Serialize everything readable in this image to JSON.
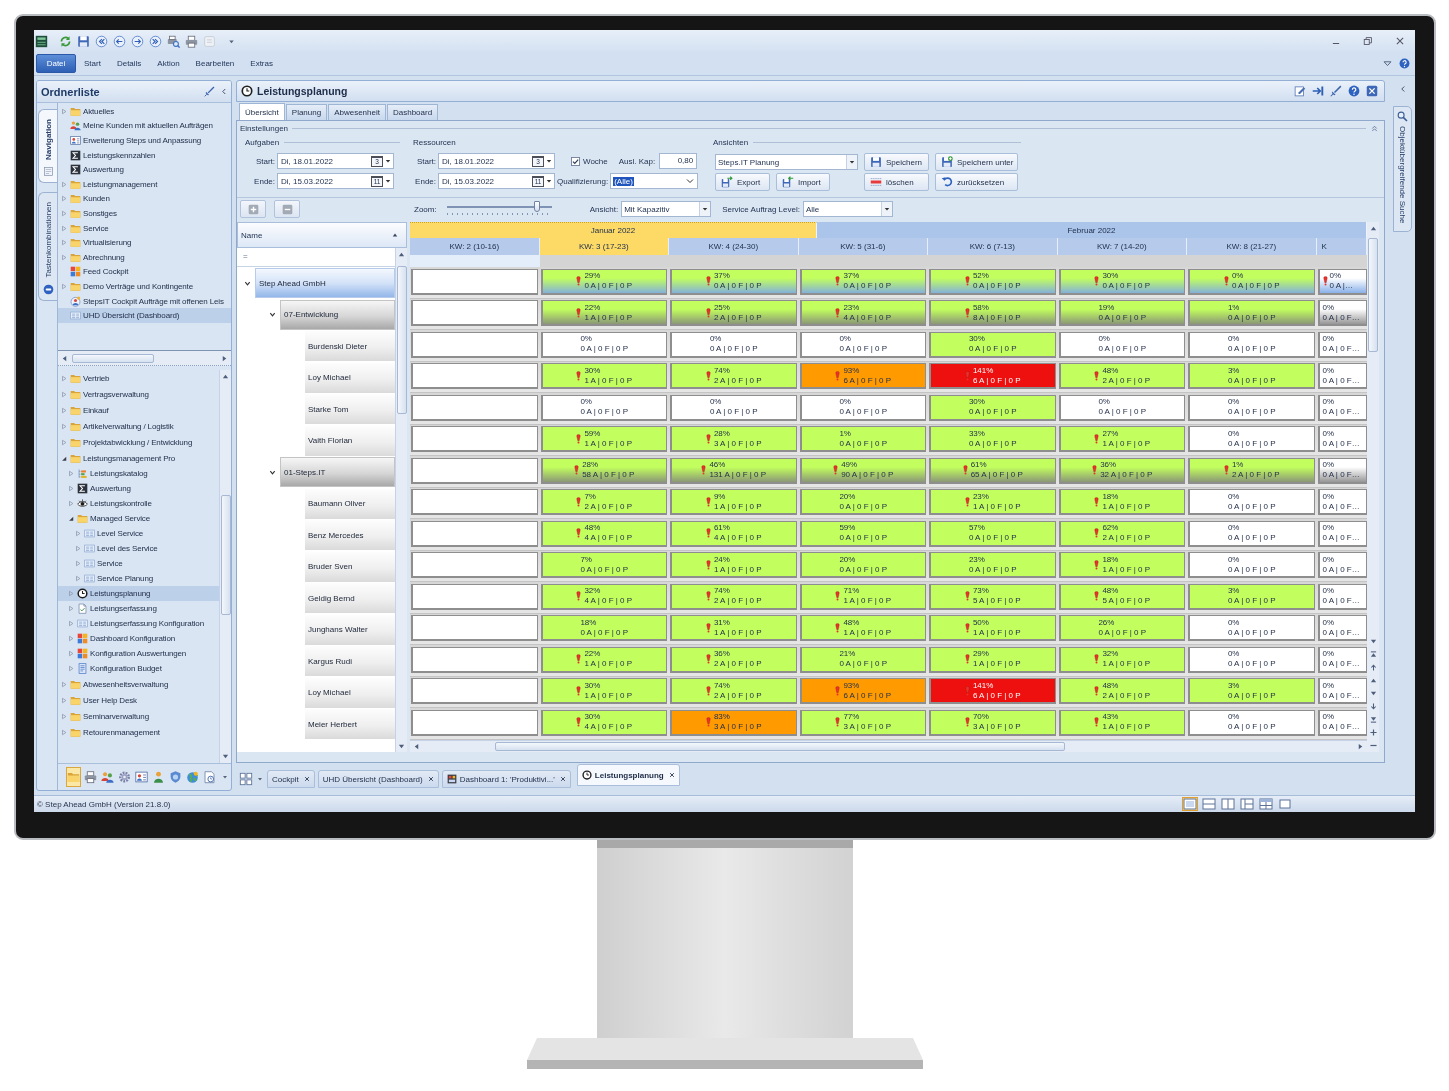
{
  "ribbon": {
    "file_button": "Datei",
    "tabs": [
      "Start",
      "Details",
      "Aktion",
      "Bearbeiten",
      "Extras"
    ]
  },
  "folder_panel": {
    "title": "Ordnerliste",
    "side_tabs": [
      {
        "label": "Navigation",
        "kind": "navigation",
        "selected": true
      },
      {
        "label": "Tastenkombinationen",
        "kind": "shortcuts",
        "selected": false
      }
    ],
    "tree_top": [
      {
        "label": "Aktuelles",
        "kind": "folder",
        "expanded": false,
        "selected": false
      },
      {
        "label": "Meine Kunden mit aktuellen Aufträgen",
        "kind": "people",
        "selected": false
      },
      {
        "label": "Erweiterung Steps und Anpassung",
        "kind": "card",
        "selected": false
      },
      {
        "label": "Leistungskennzahlen",
        "kind": "sigma",
        "selected": false
      },
      {
        "label": "Auswertung",
        "kind": "sigma",
        "selected": false
      },
      {
        "label": "Leistungmanagement",
        "kind": "folder",
        "expanded": false,
        "selected": false
      },
      {
        "label": "Kunden",
        "kind": "folder",
        "expanded": false,
        "selected": false
      },
      {
        "label": "Sonstiges",
        "kind": "folder",
        "expanded": false,
        "selected": false
      },
      {
        "label": "Service",
        "kind": "folder",
        "expanded": false,
        "selected": false
      },
      {
        "label": "Virtualisierung",
        "kind": "folder",
        "expanded": false,
        "selected": false
      },
      {
        "label": "Abrechnung",
        "kind": "folder",
        "expanded": false,
        "selected": false
      },
      {
        "label": "Feed Cockpit",
        "kind": "blocks",
        "selected": false
      },
      {
        "label": "Demo Verträge und Kontingente",
        "kind": "folder",
        "expanded": false,
        "selected": false
      },
      {
        "label": "StepsIT Cockpit Aufträge mit offenen Leis",
        "kind": "cockpit",
        "selected": false
      },
      {
        "label": "UHD Übersicht (Dashboard)",
        "kind": "table",
        "selected": true
      }
    ],
    "tree_bottom": [
      {
        "label": "Vertrieb",
        "kind": "folder",
        "expanded": false,
        "selected": false
      },
      {
        "label": "Vertragsverwaltung",
        "kind": "folder",
        "expanded": false,
        "selected": false
      },
      {
        "label": "Einkauf",
        "kind": "folder",
        "expanded": false,
        "selected": false
      },
      {
        "label": "Artikelverwaltung / Logistik",
        "kind": "folder",
        "expanded": false,
        "selected": false
      },
      {
        "label": "Projektabwicklung / Entwicklung",
        "kind": "folder",
        "expanded": false,
        "selected": false
      },
      {
        "label": "Leistungsmanagement Pro",
        "kind": "folder",
        "expanded": true,
        "selected": false,
        "children": [
          {
            "label": "Leistungskatalog",
            "kind": "list",
            "expanded": false,
            "selected": false
          },
          {
            "label": "Auswertung",
            "kind": "sigma",
            "expanded": false,
            "selected": false
          },
          {
            "label": "Leistungskontrolle",
            "kind": "eye",
            "expanded": false,
            "selected": false
          },
          {
            "label": "Managed Service",
            "kind": "folder",
            "expanded": true,
            "selected": false,
            "children": [
              {
                "label": "Level Service",
                "kind": "table",
                "expanded": false,
                "selected": false
              },
              {
                "label": "Level des Service",
                "kind": "table",
                "expanded": false,
                "selected": false
              },
              {
                "label": "Service",
                "kind": "table",
                "expanded": false,
                "selected": false
              },
              {
                "label": "Service Planung",
                "kind": "table",
                "expanded": false,
                "selected": false
              }
            ]
          },
          {
            "label": "Leistungsplanung",
            "kind": "clock",
            "expanded": false,
            "selected": true
          },
          {
            "label": "Leistungserfassung",
            "kind": "doc",
            "expanded": false,
            "selected": false
          },
          {
            "label": "Leistungserfassung Konfiguration",
            "kind": "table",
            "expanded": false,
            "selected": false
          },
          {
            "label": "Dashboard Konfiguration",
            "kind": "blocks",
            "expanded": false,
            "selected": false
          },
          {
            "label": "Konfiguration Auswertungen",
            "kind": "blocks",
            "expanded": false,
            "selected": false
          },
          {
            "label": "Konfiguration Budget",
            "kind": "budget",
            "expanded": false,
            "selected": false
          }
        ]
      },
      {
        "label": "Abwesenheitsverwaltung",
        "kind": "folder",
        "expanded": false,
        "selected": false
      },
      {
        "label": "User Help Desk",
        "kind": "folder",
        "expanded": false,
        "selected": false
      },
      {
        "label": "Seminarverwaltung",
        "kind": "folder",
        "expanded": false,
        "selected": false
      },
      {
        "label": "Retourenmanagement",
        "kind": "folder",
        "expanded": false,
        "selected": false
      }
    ],
    "shortcut_buttons": [
      {
        "kind": "folder",
        "selected": true
      },
      {
        "kind": "printer",
        "selected": false
      },
      {
        "kind": "people",
        "selected": false
      },
      {
        "kind": "gear",
        "selected": false
      },
      {
        "kind": "card",
        "selected": false
      },
      {
        "kind": "person",
        "selected": false
      },
      {
        "kind": "shield",
        "selected": false
      },
      {
        "kind": "globe",
        "selected": false
      },
      {
        "kind": "report",
        "selected": false
      }
    ]
  },
  "module": {
    "title": "Leistungsplanung",
    "tabs": [
      {
        "label": "Übersicht",
        "selected": true
      },
      {
        "label": "Planung",
        "selected": false
      },
      {
        "label": "Abwesenheit",
        "selected": false
      },
      {
        "label": "Dashboard",
        "selected": false
      }
    ],
    "settings": {
      "title": "Einstellungen",
      "tasks": {
        "title": "Aufgaben",
        "start": {
          "label": "Start:",
          "value": "Di, 18.01.2022",
          "day": "3"
        },
        "end": {
          "label": "Ende:",
          "value": "Di, 15.03.2022",
          "day": "11"
        }
      },
      "resources": {
        "title": "Ressourcen",
        "start": {
          "label": "Start:",
          "value": "Di, 18.01.2022",
          "day": "3"
        },
        "end": {
          "label": "Ende:",
          "value": "Di, 15.03.2022",
          "day": "11"
        },
        "week": {
          "label": "Woche",
          "checked": true
        },
        "capacity": {
          "label": "Ausl. Kap:",
          "value": "0,80"
        },
        "qualification": {
          "label": "Qualifizierung:",
          "value": "(Alle)",
          "highlighted": true
        }
      },
      "views": {
        "title": "Ansichten",
        "layout": "Steps.IT Planung",
        "buttons": [
          {
            "label": "Speichern",
            "kind": "save"
          },
          {
            "label": "Speichern unter",
            "kind": "save_as"
          },
          {
            "label": "Export",
            "kind": "export"
          },
          {
            "label": "Import",
            "kind": "import"
          },
          {
            "label": "löschen",
            "kind": "delete"
          },
          {
            "label": "zurücksetzen",
            "kind": "reset"
          }
        ]
      }
    },
    "toolbar": {
      "zoom": {
        "label": "Zoom:",
        "level": 0.86
      },
      "view": {
        "label": "Ansicht:",
        "value": "Mit Kapazitiv"
      },
      "service_level": {
        "label": "Service Auftrag Level:",
        "value": "Alle"
      }
    },
    "grid": {
      "name_header": "Name",
      "filter": "=",
      "months": [
        {
          "label": "Januar 2022",
          "current": true
        },
        {
          "label": "Februar 2022",
          "current": false
        }
      ],
      "weeks": [
        {
          "label": "KW: 2 (10-16)",
          "current": false
        },
        {
          "label": "KW: 3 (17-23)",
          "current": true
        },
        {
          "label": "KW: 4 (24-30)",
          "current": false
        },
        {
          "label": "KW: 5 (31-6)",
          "current": false
        },
        {
          "label": "KW: 6 (7-13)",
          "current": false
        },
        {
          "label": "KW: 7 (14-20)",
          "current": false
        },
        {
          "label": "KW: 8 (21-27)",
          "current": false
        },
        {
          "label": "K",
          "current": false
        }
      ],
      "rows": [
        {
          "name": "Step Ahead GmbH",
          "kind": "company",
          "expanded": true,
          "cells": [
            {
              "percent": "29%",
              "counts": "0 A | 0 F | 0 P",
              "color": "#c2ff5e",
              "warning": true
            },
            {
              "percent": "37%",
              "counts": "0 A | 0 F | 0 P",
              "color": "#c2ff5e",
              "warning": true
            },
            {
              "percent": "37%",
              "counts": "0 A | 0 F | 0 P",
              "color": "#c2ff5e",
              "warning": true
            },
            {
              "percent": "52%",
              "counts": "0 A | 0 F | 0 P",
              "color": "#c2ff5e",
              "warning": true
            },
            {
              "percent": "30%",
              "counts": "0 A | 0 F | 0 P",
              "color": "#c2ff5e",
              "warning": true
            },
            {
              "percent": "0%",
              "counts": "0 A | 0 F | 0 P",
              "color": "#c2ff5e",
              "warning": true
            },
            {
              "percent": "0%",
              "counts": "0 A |…",
              "color": "#ffffff",
              "warning": true
            }
          ],
          "children": [
            {
              "name": "07-Entwicklung",
              "kind": "team",
              "expanded": true,
              "cells": [
                {
                  "percent": "22%",
                  "counts": "1 A | 0 F | 0 P",
                  "color": "#c2ff5e",
                  "warning": true
                },
                {
                  "percent": "25%",
                  "counts": "2 A | 0 F | 0 P",
                  "color": "#c2ff5e",
                  "warning": true
                },
                {
                  "percent": "23%",
                  "counts": "4 A | 0 F | 0 P",
                  "color": "#c2ff5e",
                  "warning": true
                },
                {
                  "percent": "58%",
                  "counts": "8 A | 0 F | 0 P",
                  "color": "#c2ff5e",
                  "warning": true
                },
                {
                  "percent": "19%",
                  "counts": "0 A | 0 F | 0 P",
                  "color": "#c2ff5e",
                  "warning": false
                },
                {
                  "percent": "1%",
                  "counts": "0 A | 0 F | 0 P",
                  "color": "#c2ff5e",
                  "warning": false
                },
                {
                  "percent": "0%",
                  "counts": "0 A | 0 F…",
                  "color": "#ffffff",
                  "warning": false
                }
              ],
              "children": [
                {
                  "name": "Burdenski Dieter",
                  "kind": "person",
                  "cells": [
                    {
                      "percent": "0%",
                      "counts": "0 A | 0 F | 0 P",
                      "color": "#ffffff",
                      "warning": false
                    },
                    {
                      "percent": "0%",
                      "counts": "0 A | 0 F | 0 P",
                      "color": "#ffffff",
                      "warning": false
                    },
                    {
                      "percent": "0%",
                      "counts": "0 A | 0 F | 0 P",
                      "color": "#ffffff",
                      "warning": false
                    },
                    {
                      "percent": "30%",
                      "counts": "0 A | 0 F | 0 P",
                      "color": "#c2ff5e",
                      "warning": false
                    },
                    {
                      "percent": "0%",
                      "counts": "0 A | 0 F | 0 P",
                      "color": "#ffffff",
                      "warning": false
                    },
                    {
                      "percent": "0%",
                      "counts": "0 A | 0 F | 0 P",
                      "color": "#ffffff",
                      "warning": false
                    },
                    {
                      "percent": "0%",
                      "counts": "0 A | 0 F…",
                      "color": "#ffffff",
                      "warning": false
                    }
                  ]
                },
                {
                  "name": "Loy Michael",
                  "kind": "person",
                  "cells": [
                    {
                      "percent": "30%",
                      "counts": "1 A | 0 F | 0 P",
                      "color": "#c2ff5e",
                      "warning": true
                    },
                    {
                      "percent": "74%",
                      "counts": "2 A | 0 F | 0 P",
                      "color": "#c2ff5e",
                      "warning": true
                    },
                    {
                      "percent": "93%",
                      "counts": "6 A | 0 F | 0 P",
                      "color": "#ff9a00",
                      "warning": true
                    },
                    {
                      "percent": "141%",
                      "counts": "6 A | 0 F | 0 P",
                      "color": "#ee0f0f",
                      "warning": true
                    },
                    {
                      "percent": "48%",
                      "counts": "2 A | 0 F | 0 P",
                      "color": "#c2ff5e",
                      "warning": true
                    },
                    {
                      "percent": "3%",
                      "counts": "0 A | 0 F | 0 P",
                      "color": "#c2ff5e",
                      "warning": false
                    },
                    {
                      "percent": "0%",
                      "counts": "0 A | 0 F…",
                      "color": "#ffffff",
                      "warning": false
                    }
                  ]
                },
                {
                  "name": "Starke Tom",
                  "kind": "person",
                  "cells": [
                    {
                      "percent": "0%",
                      "counts": "0 A | 0 F | 0 P",
                      "color": "#ffffff",
                      "warning": false
                    },
                    {
                      "percent": "0%",
                      "counts": "0 A | 0 F | 0 P",
                      "color": "#ffffff",
                      "warning": false
                    },
                    {
                      "percent": "0%",
                      "counts": "0 A | 0 F | 0 P",
                      "color": "#ffffff",
                      "warning": false
                    },
                    {
                      "percent": "30%",
                      "counts": "0 A | 0 F | 0 P",
                      "color": "#c2ff5e",
                      "warning": false
                    },
                    {
                      "percent": "0%",
                      "counts": "0 A | 0 F | 0 P",
                      "color": "#ffffff",
                      "warning": false
                    },
                    {
                      "percent": "0%",
                      "counts": "0 A | 0 F | 0 P",
                      "color": "#ffffff",
                      "warning": false
                    },
                    {
                      "percent": "0%",
                      "counts": "0 A | 0 F…",
                      "color": "#ffffff",
                      "warning": false
                    }
                  ]
                },
                {
                  "name": "Vaith Florian",
                  "kind": "person",
                  "cells": [
                    {
                      "percent": "59%",
                      "counts": "1 A | 0 F | 0 P",
                      "color": "#c2ff5e",
                      "warning": true
                    },
                    {
                      "percent": "28%",
                      "counts": "3 A | 0 F | 0 P",
                      "color": "#c2ff5e",
                      "warning": true
                    },
                    {
                      "percent": "1%",
                      "counts": "0 A | 0 F | 0 P",
                      "color": "#c2ff5e",
                      "warning": false
                    },
                    {
                      "percent": "33%",
                      "counts": "0 A | 0 F | 0 P",
                      "color": "#c2ff5e",
                      "warning": false
                    },
                    {
                      "percent": "27%",
                      "counts": "1 A | 0 F | 0 P",
                      "color": "#c2ff5e",
                      "warning": true
                    },
                    {
                      "percent": "0%",
                      "counts": "0 A | 0 F | 0 P",
                      "color": "#ffffff",
                      "warning": false
                    },
                    {
                      "percent": "0%",
                      "counts": "0 A | 0 F…",
                      "color": "#ffffff",
                      "warning": false
                    }
                  ]
                }
              ]
            },
            {
              "name": "01-Steps.IT",
              "kind": "team",
              "expanded": true,
              "cells": [
                {
                  "percent": "28%",
                  "counts": "58 A | 0 F | 0 P",
                  "color": "#c2ff5e",
                  "warning": true
                },
                {
                  "percent": "46%",
                  "counts": "131 A | 0 F | 0 P",
                  "color": "#c2ff5e",
                  "warning": true
                },
                {
                  "percent": "49%",
                  "counts": "90 A | 0 F | 0 P",
                  "color": "#c2ff5e",
                  "warning": true
                },
                {
                  "percent": "61%",
                  "counts": "65 A | 0 F | 0 P",
                  "color": "#c2ff5e",
                  "warning": true
                },
                {
                  "percent": "36%",
                  "counts": "32 A | 0 F | 0 P",
                  "color": "#c2ff5e",
                  "warning": true
                },
                {
                  "percent": "1%",
                  "counts": "2 A | 0 F | 0 P",
                  "color": "#c2ff5e",
                  "warning": true
                },
                {
                  "percent": "0%",
                  "counts": "0 A | 0 F…",
                  "color": "#ffffff",
                  "warning": false
                }
              ],
              "children": [
                {
                  "name": "Baumann Oliver",
                  "kind": "person",
                  "cells": [
                    {
                      "percent": "7%",
                      "counts": "2 A | 0 F | 0 P",
                      "color": "#c2ff5e",
                      "warning": true
                    },
                    {
                      "percent": "9%",
                      "counts": "1 A | 0 F | 0 P",
                      "color": "#c2ff5e",
                      "warning": true
                    },
                    {
                      "percent": "20%",
                      "counts": "0 A | 0 F | 0 P",
                      "color": "#c2ff5e",
                      "warning": false
                    },
                    {
                      "percent": "23%",
                      "counts": "1 A | 0 F | 0 P",
                      "color": "#c2ff5e",
                      "warning": true
                    },
                    {
                      "percent": "18%",
                      "counts": "1 A | 0 F | 0 P",
                      "color": "#c2ff5e",
                      "warning": true
                    },
                    {
                      "percent": "0%",
                      "counts": "0 A | 0 F | 0 P",
                      "color": "#ffffff",
                      "warning": false
                    },
                    {
                      "percent": "0%",
                      "counts": "0 A | 0 F…",
                      "color": "#ffffff",
                      "warning": false
                    }
                  ]
                },
                {
                  "name": "Benz Mercedes",
                  "kind": "person",
                  "cells": [
                    {
                      "percent": "48%",
                      "counts": "4 A | 0 F | 0 P",
                      "color": "#c2ff5e",
                      "warning": true
                    },
                    {
                      "percent": "61%",
                      "counts": "4 A | 0 F | 0 P",
                      "color": "#c2ff5e",
                      "warning": true
                    },
                    {
                      "percent": "59%",
                      "counts": "0 A | 0 F | 0 P",
                      "color": "#c2ff5e",
                      "warning": false
                    },
                    {
                      "percent": "57%",
                      "counts": "0 A | 0 F | 0 P",
                      "color": "#c2ff5e",
                      "warning": false
                    },
                    {
                      "percent": "62%",
                      "counts": "2 A | 0 F | 0 P",
                      "color": "#c2ff5e",
                      "warning": true
                    },
                    {
                      "percent": "0%",
                      "counts": "0 A | 0 F | 0 P",
                      "color": "#ffffff",
                      "warning": false
                    },
                    {
                      "percent": "0%",
                      "counts": "0 A | 0 F…",
                      "color": "#ffffff",
                      "warning": false
                    }
                  ]
                },
                {
                  "name": "Bruder Sven",
                  "kind": "person",
                  "cells": [
                    {
                      "percent": "7%",
                      "counts": "0 A | 0 F | 0 P",
                      "color": "#c2ff5e",
                      "warning": false
                    },
                    {
                      "percent": "24%",
                      "counts": "1 A | 0 F | 0 P",
                      "color": "#c2ff5e",
                      "warning": true
                    },
                    {
                      "percent": "20%",
                      "counts": "0 A | 0 F | 0 P",
                      "color": "#c2ff5e",
                      "warning": false
                    },
                    {
                      "percent": "23%",
                      "counts": "0 A | 0 F | 0 P",
                      "color": "#c2ff5e",
                      "warning": false
                    },
                    {
                      "percent": "18%",
                      "counts": "1 A | 0 F | 0 P",
                      "color": "#c2ff5e",
                      "warning": true
                    },
                    {
                      "percent": "0%",
                      "counts": "0 A | 0 F | 0 P",
                      "color": "#ffffff",
                      "warning": false
                    },
                    {
                      "percent": "0%",
                      "counts": "0 A | 0 F…",
                      "color": "#ffffff",
                      "warning": false
                    }
                  ]
                },
                {
                  "name": "Geldig Bernd",
                  "kind": "person",
                  "cells": [
                    {
                      "percent": "32%",
                      "counts": "4 A | 0 F | 0 P",
                      "color": "#c2ff5e",
                      "warning": true
                    },
                    {
                      "percent": "74%",
                      "counts": "2 A | 0 F | 0 P",
                      "color": "#c2ff5e",
                      "warning": true
                    },
                    {
                      "percent": "71%",
                      "counts": "1 A | 0 F | 0 P",
                      "color": "#c2ff5e",
                      "warning": true
                    },
                    {
                      "percent": "73%",
                      "counts": "5 A | 0 F | 0 P",
                      "color": "#c2ff5e",
                      "warning": true
                    },
                    {
                      "percent": "48%",
                      "counts": "5 A | 0 F | 0 P",
                      "color": "#c2ff5e",
                      "warning": true
                    },
                    {
                      "percent": "3%",
                      "counts": "0 A | 0 F | 0 P",
                      "color": "#c2ff5e",
                      "warning": false
                    },
                    {
                      "percent": "0%",
                      "counts": "0 A | 0 F…",
                      "color": "#ffffff",
                      "warning": false
                    }
                  ]
                },
                {
                  "name": "Junghans Walter",
                  "kind": "person",
                  "cells": [
                    {
                      "percent": "18%",
                      "counts": "0 A | 0 F | 0 P",
                      "color": "#c2ff5e",
                      "warning": false
                    },
                    {
                      "percent": "31%",
                      "counts": "1 A | 0 F | 0 P",
                      "color": "#c2ff5e",
                      "warning": true
                    },
                    {
                      "percent": "48%",
                      "counts": "1 A | 0 F | 0 P",
                      "color": "#c2ff5e",
                      "warning": true
                    },
                    {
                      "percent": "50%",
                      "counts": "1 A | 0 F | 0 P",
                      "color": "#c2ff5e",
                      "warning": true
                    },
                    {
                      "percent": "26%",
                      "counts": "0 A | 0 F | 0 P",
                      "color": "#c2ff5e",
                      "warning": false
                    },
                    {
                      "percent": "0%",
                      "counts": "0 A | 0 F | 0 P",
                      "color": "#ffffff",
                      "warning": false
                    },
                    {
                      "percent": "0%",
                      "counts": "0 A | 0 F…",
                      "color": "#ffffff",
                      "warning": false
                    }
                  ]
                },
                {
                  "name": "Kargus Rudi",
                  "kind": "person",
                  "cells": [
                    {
                      "percent": "22%",
                      "counts": "1 A | 0 F | 0 P",
                      "color": "#c2ff5e",
                      "warning": true
                    },
                    {
                      "percent": "36%",
                      "counts": "2 A | 0 F | 0 P",
                      "color": "#c2ff5e",
                      "warning": true
                    },
                    {
                      "percent": "21%",
                      "counts": "0 A | 0 F | 0 P",
                      "color": "#c2ff5e",
                      "warning": false
                    },
                    {
                      "percent": "29%",
                      "counts": "1 A | 0 F | 0 P",
                      "color": "#c2ff5e",
                      "warning": true
                    },
                    {
                      "percent": "32%",
                      "counts": "1 A | 0 F | 0 P",
                      "color": "#c2ff5e",
                      "warning": true
                    },
                    {
                      "percent": "0%",
                      "counts": "0 A | 0 F | 0 P",
                      "color": "#ffffff",
                      "warning": false
                    },
                    {
                      "percent": "0%",
                      "counts": "0 A | 0 F…",
                      "color": "#ffffff",
                      "warning": false
                    }
                  ]
                },
                {
                  "name": "Loy Michael",
                  "kind": "person",
                  "cells": [
                    {
                      "percent": "30%",
                      "counts": "1 A | 0 F | 0 P",
                      "color": "#c2ff5e",
                      "warning": true
                    },
                    {
                      "percent": "74%",
                      "counts": "2 A | 0 F | 0 P",
                      "color": "#c2ff5e",
                      "warning": true
                    },
                    {
                      "percent": "93%",
                      "counts": "6 A | 0 F | 0 P",
                      "color": "#ff9a00",
                      "warning": true
                    },
                    {
                      "percent": "141%",
                      "counts": "6 A | 0 F | 0 P",
                      "color": "#ee0f0f",
                      "warning": true
                    },
                    {
                      "percent": "48%",
                      "counts": "2 A | 0 F | 0 P",
                      "color": "#c2ff5e",
                      "warning": true
                    },
                    {
                      "percent": "3%",
                      "counts": "0 A | 0 F | 0 P",
                      "color": "#c2ff5e",
                      "warning": false
                    },
                    {
                      "percent": "0%",
                      "counts": "0 A | 0 F…",
                      "color": "#ffffff",
                      "warning": false
                    }
                  ]
                },
                {
                  "name": "Meier Herbert",
                  "kind": "person",
                  "cells": [
                    {
                      "percent": "30%",
                      "counts": "4 A | 0 F | 0 P",
                      "color": "#c2ff5e",
                      "warning": true
                    },
                    {
                      "percent": "83%",
                      "counts": "3 A | 0 F | 0 P",
                      "color": "#ff9a00",
                      "warning": true
                    },
                    {
                      "percent": "77%",
                      "counts": "3 A | 0 F | 0 P",
                      "color": "#c2ff5e",
                      "warning": true
                    },
                    {
                      "percent": "70%",
                      "counts": "3 A | 0 F | 0 P",
                      "color": "#c2ff5e",
                      "warning": true
                    },
                    {
                      "percent": "43%",
                      "counts": "1 A | 0 F | 0 P",
                      "color": "#c2ff5e",
                      "warning": true
                    },
                    {
                      "percent": "0%",
                      "counts": "0 A | 0 F | 0 P",
                      "color": "#ffffff",
                      "warning": false
                    },
                    {
                      "percent": "0%",
                      "counts": "0 A | 0 F…",
                      "color": "#ffffff",
                      "warning": false
                    }
                  ]
                }
              ]
            }
          ]
        }
      ]
    }
  },
  "document_tabs": [
    {
      "label": "Cockpit",
      "kind": "plain",
      "selected": false
    },
    {
      "label": "UHD Übersicht (Dashboard)",
      "kind": "plain",
      "selected": false
    },
    {
      "label": "Dashboard 1: 'Produktivi...'",
      "kind": "dashboard",
      "selected": false
    },
    {
      "label": "Leistungsplanung",
      "kind": "clock",
      "selected": true
    }
  ],
  "search_panel": {
    "label": "Objektübergreifende Suche"
  },
  "status_bar": {
    "text": "© Step Ahead GmbH (Version 21.8.0)",
    "view_buttons": [
      {
        "kind": "normal",
        "selected": true
      },
      {
        "kind": "rows",
        "selected": false
      },
      {
        "kind": "columns",
        "selected": false
      },
      {
        "kind": "split",
        "selected": false
      },
      {
        "kind": "grid",
        "selected": false
      },
      {
        "kind": "full",
        "selected": false
      }
    ]
  }
}
